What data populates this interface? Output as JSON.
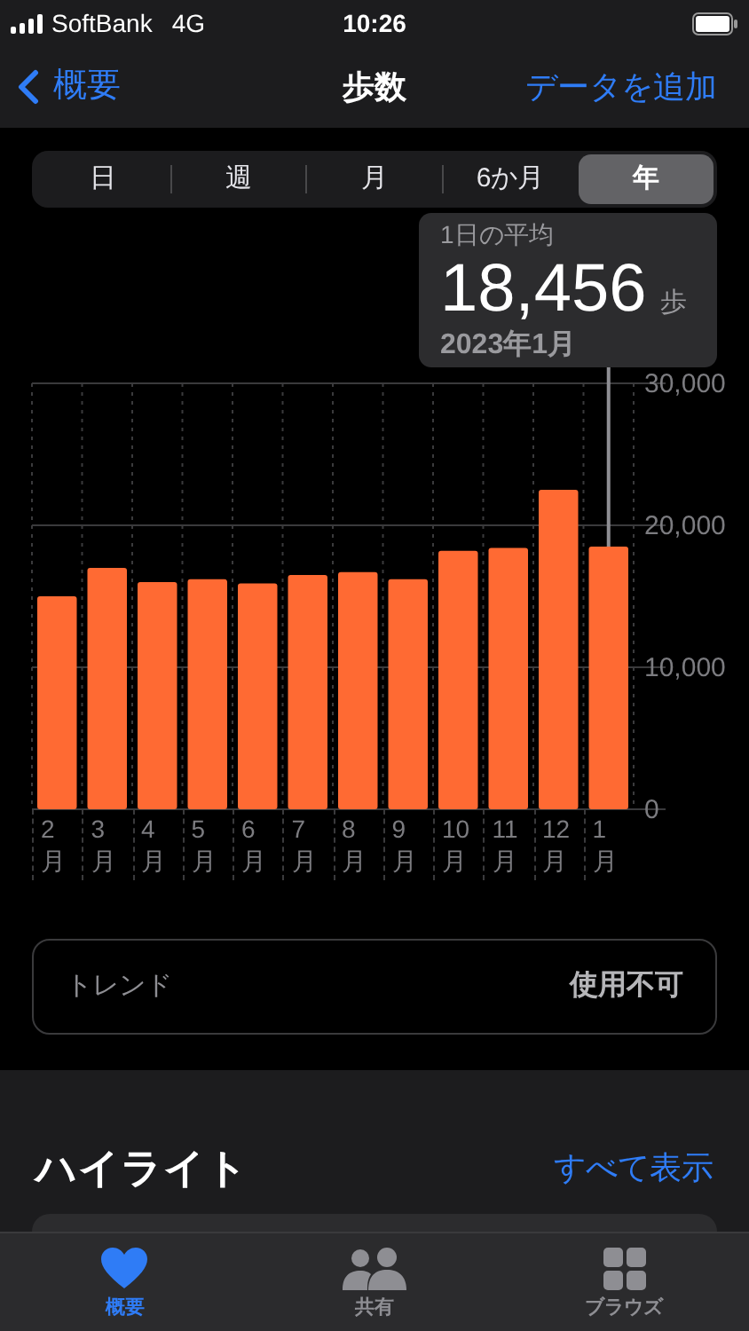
{
  "status_bar": {
    "carrier": "SoftBank",
    "network": "4G",
    "time": "10:26"
  },
  "nav": {
    "back": "概要",
    "title": "歩数",
    "action": "データを追加"
  },
  "segments": [
    {
      "label": "日",
      "selected": false
    },
    {
      "label": "週",
      "selected": false
    },
    {
      "label": "月",
      "selected": false
    },
    {
      "label": "6か月",
      "selected": false
    },
    {
      "label": "年",
      "selected": true
    }
  ],
  "tooltip": {
    "label": "1日の平均",
    "value": "18,456",
    "unit": "歩",
    "date": "2023年1月"
  },
  "chart_data": {
    "type": "bar",
    "categories": [
      "2\n月",
      "3\n月",
      "4\n月",
      "5\n月",
      "6\n月",
      "7\n月",
      "8\n月",
      "9\n月",
      "10\n月",
      "11\n月",
      "12\n月",
      "1\n月"
    ],
    "series": [
      {
        "color": "#ff6a33",
        "values": [
          15000,
          17000,
          16000,
          16200,
          15900,
          16500,
          16700,
          16200,
          18200,
          18400,
          22500,
          18500
        ]
      }
    ],
    "ylim": [
      0,
      30000
    ],
    "yticks": [
      {
        "value": 0,
        "label": "0"
      },
      {
        "value": 10000,
        "label": "10,000"
      },
      {
        "value": 20000,
        "label": "20,000"
      },
      {
        "value": 30000,
        "label": "30,000"
      }
    ]
  },
  "trend": {
    "label": "トレンド",
    "value": "使用不可"
  },
  "highlights": {
    "title": "ハイライト",
    "link": "すべて表示"
  },
  "tab_bar": [
    {
      "label": "概要",
      "kind": "heart",
      "selected": true
    },
    {
      "label": "共有",
      "kind": "people",
      "selected": false
    },
    {
      "label": "ブラウズ",
      "kind": "grid",
      "selected": false
    }
  ]
}
